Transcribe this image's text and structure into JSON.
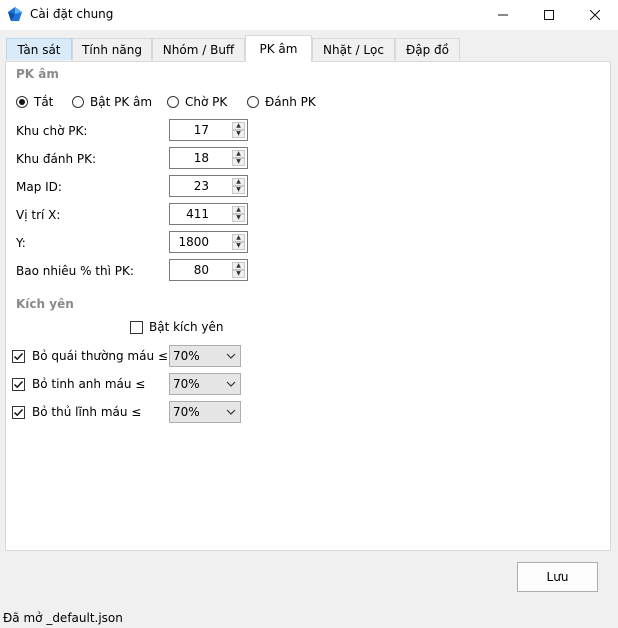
{
  "window": {
    "title": "Cài đặt chung"
  },
  "tabs": [
    {
      "label": "Tàn sát"
    },
    {
      "label": "Tính năng"
    },
    {
      "label": "Nhóm / Buff"
    },
    {
      "label": "PK âm"
    },
    {
      "label": "Nhặt / Lọc"
    },
    {
      "label": "Đập đồ"
    }
  ],
  "selected_tab": "PK âm",
  "pk_group": {
    "title": "PK âm",
    "mode_options": [
      {
        "label": "Tắt",
        "selected": true
      },
      {
        "label": "Bật PK âm",
        "selected": false
      },
      {
        "label": "Chờ PK",
        "selected": false
      },
      {
        "label": "Đánh PK",
        "selected": false
      }
    ],
    "fields": [
      {
        "label": "Khu chờ PK:",
        "value": "17"
      },
      {
        "label": "Khu đánh PK:",
        "value": "18"
      },
      {
        "label": "Map ID:",
        "value": "23"
      },
      {
        "label": "Vị trí X:",
        "value": "411"
      },
      {
        "label": "Y:",
        "value": "1800"
      },
      {
        "label": "Bao nhiêu % thì PK:",
        "value": "80"
      }
    ]
  },
  "kich_yen_group": {
    "title": "Kích yên",
    "enable_label": "Bật kích yên",
    "enable_checked": false,
    "rules": [
      {
        "label": "Bỏ quái thường máu ≤",
        "checked": true,
        "value": "70%"
      },
      {
        "label": "Bỏ tinh anh máu ≤",
        "checked": true,
        "value": "70%"
      },
      {
        "label": "Bỏ thủ lĩnh máu ≤",
        "checked": true,
        "value": "70%"
      }
    ]
  },
  "buttons": {
    "save": "Lưu"
  },
  "status": {
    "text": "Đã mở _default.json"
  }
}
